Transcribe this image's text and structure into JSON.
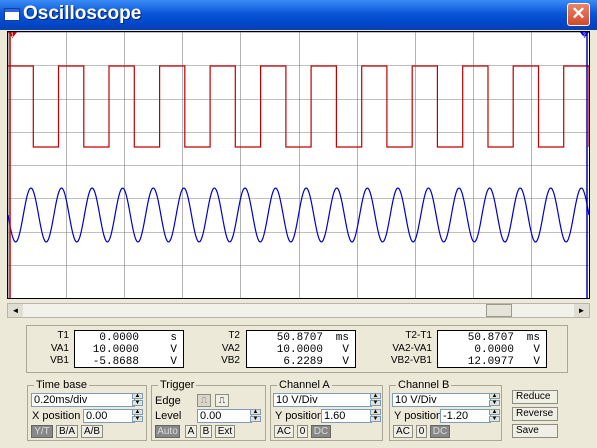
{
  "window": {
    "title": "Oscilloscope",
    "close_glyph": "✕"
  },
  "colors": {
    "channel_a": "#c00000",
    "channel_b": "#0000c8",
    "grid": "#808080",
    "titlebar": "#0054e3"
  },
  "display": {
    "marker_t1": "1",
    "marker_t2": "2"
  },
  "chart_data": {
    "type": "line",
    "series": [
      {
        "name": "Channel A",
        "waveform": "square",
        "color": "#c00000",
        "periods_visible": 11.5
      },
      {
        "name": "Channel B",
        "waveform": "sine",
        "color": "#0000c8",
        "periods_visible": 19
      }
    ],
    "grid": true
  },
  "scroll": {
    "left_icon": "◄",
    "right_icon": "►"
  },
  "readout": {
    "t1": {
      "labels": [
        "T1",
        "VA1",
        "VB1"
      ],
      "values": [
        "0.0000",
        "10.0000",
        "-5.8688"
      ],
      "units": [
        "s",
        "V",
        "V"
      ]
    },
    "t2": {
      "labels": [
        "T2",
        "VA2",
        "VB2"
      ],
      "values": [
        "50.8707",
        "10.0000",
        "6.2289"
      ],
      "units": [
        "ms",
        "V",
        "V"
      ]
    },
    "diff": {
      "labels": [
        "T2-T1",
        "VA2-VA1",
        "VB2-VB1"
      ],
      "values": [
        "50.8707",
        "0.0000",
        "12.0977"
      ],
      "units": [
        "ms",
        "V",
        "V"
      ]
    }
  },
  "time_base": {
    "legend": "Time base",
    "value": "0.20ms/div",
    "x_position_label": "X position",
    "x_position_value": "0.00",
    "mode_buttons": [
      "Y/T",
      "B/A",
      "A/B"
    ]
  },
  "trigger": {
    "legend": "Trigger",
    "edge_label": "Edge",
    "level_label": "Level",
    "level_value": "0.00",
    "rising_icon": "rising-edge-icon",
    "falling_icon": "falling-edge-icon",
    "buttons": [
      "Auto",
      "A",
      "B",
      "Ext"
    ]
  },
  "channel_a": {
    "legend": "Channel A",
    "volts_div": "10 V/Div",
    "y_position_label": "Y position",
    "y_position_value": "1.60",
    "coupling": [
      "AC",
      "0",
      "DC"
    ]
  },
  "channel_b": {
    "legend": "Channel B",
    "volts_div": "10 V/Div",
    "y_position_label": "Y position",
    "y_position_value": "-1.20",
    "coupling": [
      "AC",
      "0",
      "DC"
    ]
  },
  "actions": [
    "Reduce",
    "Reverse",
    "Save"
  ]
}
